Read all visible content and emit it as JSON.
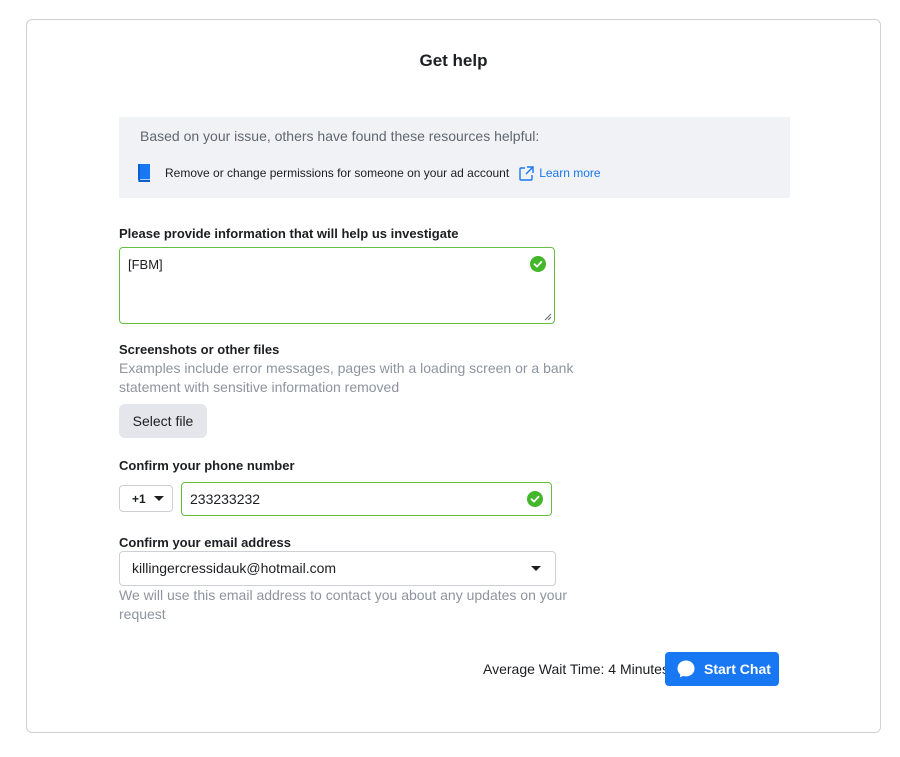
{
  "page": {
    "title": "Get help"
  },
  "resources": {
    "intro": "Based on your issue, others have found these resources helpful:",
    "item_text": "Remove or change permissions for someone on your ad account",
    "learn_more": "Learn more",
    "book_icon": "book-icon",
    "external_icon": "external-link-icon"
  },
  "investigate": {
    "label": "Please provide information that will help us investigate",
    "value": "[FBM]",
    "valid": true
  },
  "files": {
    "label": "Screenshots or other files",
    "help_line1": "Examples include error messages, pages with a loading screen or a bank",
    "help_line2": "statement with sensitive information removed",
    "button": "Select file"
  },
  "phone": {
    "label": "Confirm your phone number",
    "country_code": "+1",
    "value": "233233232",
    "valid": true
  },
  "email": {
    "label": "Confirm your email address",
    "value": "killingercressidauk@hotmail.com",
    "help_line1": "We will use this email address to contact you about any updates on your",
    "help_line2": "request"
  },
  "footer": {
    "wait_time": "Average Wait Time: 4 Minutes",
    "start_chat": "Start Chat"
  },
  "colors": {
    "accent": "#1877f2",
    "valid_green": "#42b72a",
    "valid_border": "#65c03f",
    "resource_bg": "#f0f2f5"
  }
}
